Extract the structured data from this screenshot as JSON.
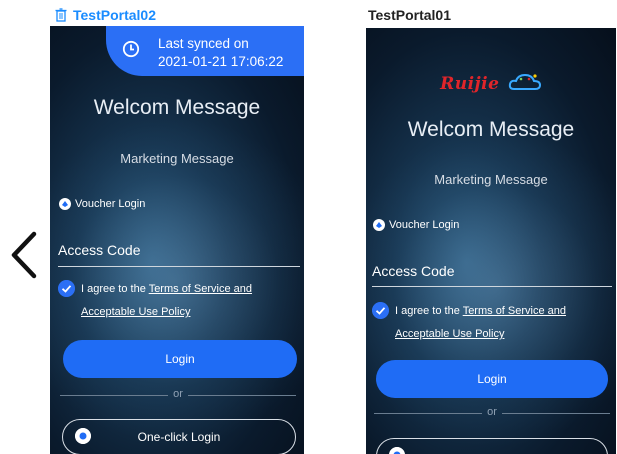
{
  "left_panel": {
    "title": "TestPortal02",
    "sync_line1": "Last synced on",
    "sync_line2": "2021-01-21 17:06:22",
    "welcome": "Welcom Message",
    "marketing": "Marketing Message",
    "voucher_login": "Voucher Login",
    "access_code": "Access Code",
    "agree_prefix": "I agree to the",
    "terms_part1": "Terms of Service and",
    "terms_part2": "Acceptable Use Policy",
    "login_label": "Login",
    "or_label": "or",
    "oneclick_label": "One-click Login"
  },
  "right_panel": {
    "title": "TestPortal01",
    "logo_text": "Ruijie",
    "welcome": "Welcom Message",
    "marketing": "Marketing Message",
    "voucher_login": "Voucher Login",
    "access_code": "Access Code",
    "agree_prefix": "I agree to the",
    "terms_part1": "Terms of Service and",
    "terms_part2": "Acceptable Use Policy",
    "login_label": "Login",
    "or_label": "or"
  },
  "icons": [
    "trash-icon",
    "chevron-left-icon",
    "clock-icon",
    "voucher-icon",
    "check-icon",
    "one-click-icon",
    "ruijie-logo"
  ],
  "colors": {
    "accent": "#1f6cf5",
    "title_blue": "#1a8cff",
    "logo_red": "#e0252a"
  }
}
